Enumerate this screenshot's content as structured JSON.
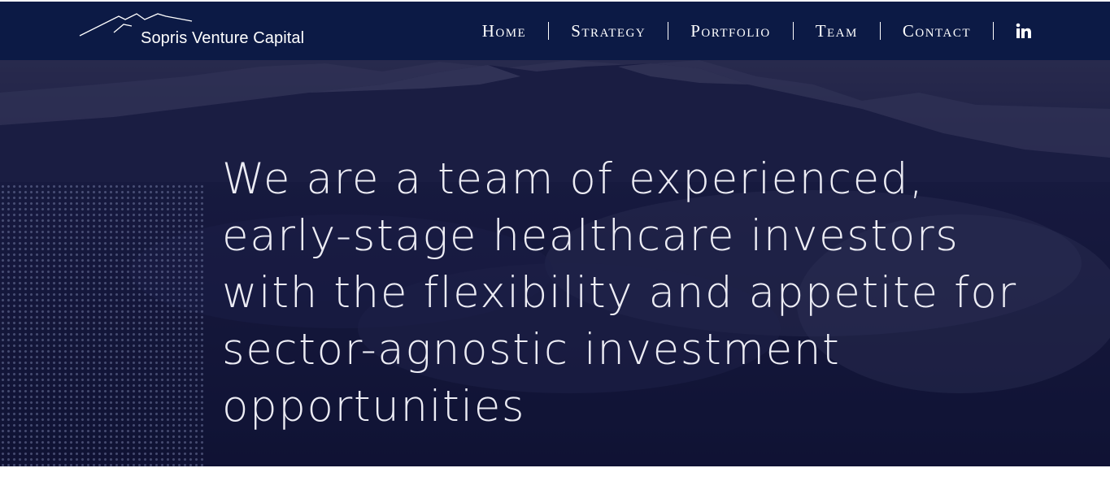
{
  "brand": {
    "name": "Sopris Venture Capital",
    "logo_icon": "mountain-outline-icon"
  },
  "nav": {
    "items": [
      {
        "label": "Home"
      },
      {
        "label": "Strategy"
      },
      {
        "label": "Portfolio"
      },
      {
        "label": "Team"
      },
      {
        "label": "Contact"
      }
    ],
    "social_icon": "linkedin-icon",
    "social_label": "in"
  },
  "hero": {
    "headline": "We are a team of experienced, early-stage healthcare investors with the flexibility and appetite for sector-agnostic investment opportunities"
  },
  "colors": {
    "header_bg": "#0c1a45",
    "hero_overlay": "#15173a",
    "text": "#ffffff"
  }
}
